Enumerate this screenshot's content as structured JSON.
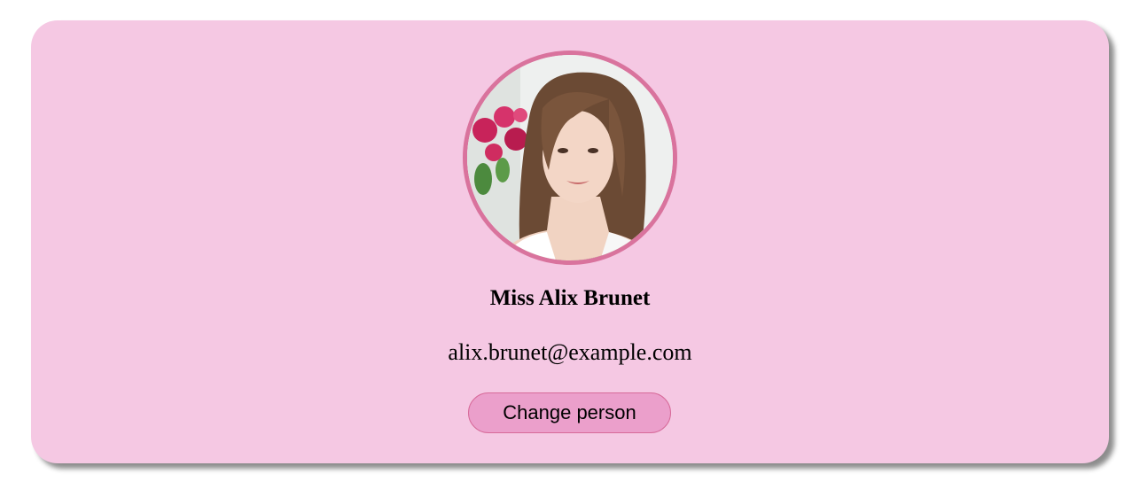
{
  "profile": {
    "name": "Miss Alix Brunet",
    "email": "alix.brunet@example.com",
    "avatar_icon": "person-photo"
  },
  "actions": {
    "change_person_label": "Change person"
  },
  "colors": {
    "card_background": "#f5c8e3",
    "avatar_border": "#d9739d",
    "button_background": "#eb9fcb",
    "button_border": "#d76a99"
  }
}
